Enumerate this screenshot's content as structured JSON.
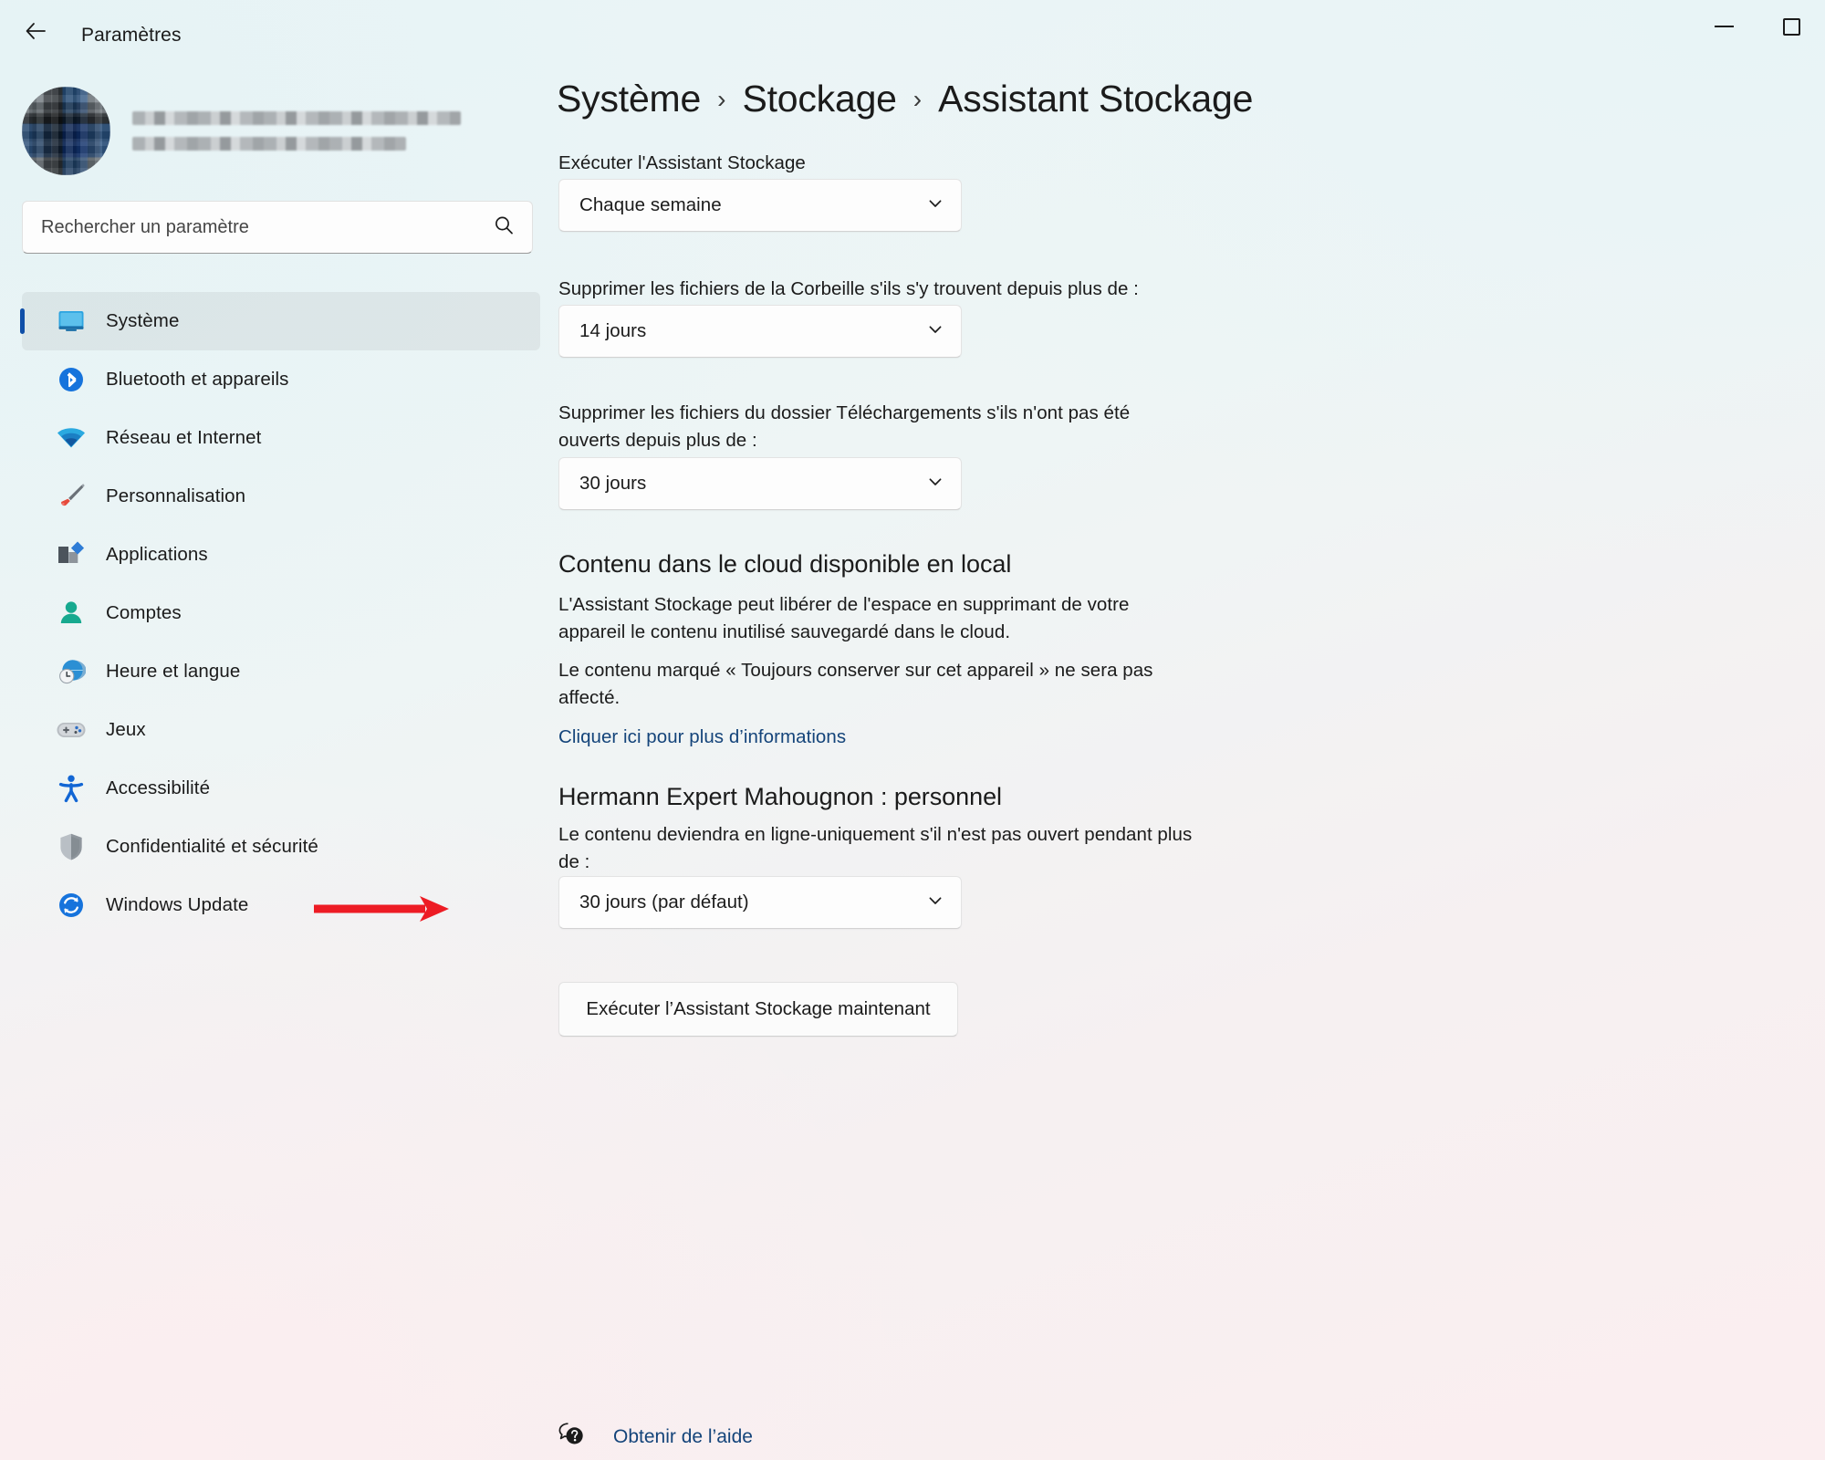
{
  "window": {
    "title": "Paramètres",
    "back_label": "Retour",
    "minimize_label": "Réduire",
    "maximize_label": "Agrandir"
  },
  "sidebar": {
    "account": {
      "name_redacted": "",
      "email_redacted": "",
      "avatar_label": "Photo de profil"
    },
    "search": {
      "placeholder": "Rechercher un paramètre",
      "value": "",
      "icon": "search-icon"
    },
    "items": [
      {
        "label": "Système",
        "icon": "monitor-icon",
        "selected": true
      },
      {
        "label": "Bluetooth et appareils",
        "icon": "bluetooth-icon",
        "selected": false
      },
      {
        "label": "Réseau et Internet",
        "icon": "wifi-icon",
        "selected": false
      },
      {
        "label": "Personnalisation",
        "icon": "paintbrush-icon",
        "selected": false
      },
      {
        "label": "Applications",
        "icon": "apps-icon",
        "selected": false
      },
      {
        "label": "Comptes",
        "icon": "person-icon",
        "selected": false
      },
      {
        "label": "Heure et langue",
        "icon": "clock-globe-icon",
        "selected": false
      },
      {
        "label": "Jeux",
        "icon": "gamepad-icon",
        "selected": false
      },
      {
        "label": "Accessibilité",
        "icon": "accessibility-icon",
        "selected": false
      },
      {
        "label": "Confidentialité et sécurité",
        "icon": "shield-icon",
        "selected": false
      },
      {
        "label": "Windows Update",
        "icon": "update-icon",
        "selected": false
      }
    ]
  },
  "main": {
    "breadcrumb": [
      {
        "label": "Système",
        "current": false
      },
      {
        "label": "Stockage",
        "current": false
      },
      {
        "label": "Assistant Stockage",
        "current": true
      }
    ],
    "breadcrumb_separator": "›",
    "run_schedule": {
      "label": "Exécuter l'Assistant Stockage",
      "value": "Chaque semaine",
      "chevron": "chevron-down-icon"
    },
    "recycle_bin": {
      "label": "Supprimer les fichiers de la Corbeille s'ils s'y trouvent depuis plus de :",
      "value": "14 jours",
      "chevron": "chevron-down-icon"
    },
    "downloads": {
      "label": "Supprimer les fichiers du dossier Téléchargements s'ils n'ont pas été ouverts depuis plus de :",
      "value": "30 jours",
      "chevron": "chevron-down-icon"
    },
    "cloud_section": {
      "heading": "Contenu dans le cloud disponible en local",
      "paragraph1": "L'Assistant Stockage peut libérer de l'espace en supprimant de votre appareil le contenu inutilisé sauvegardé dans le cloud.",
      "paragraph2": "Le contenu marqué « Toujours conserver sur cet appareil » ne sera pas affecté.",
      "link": "Cliquer ici pour plus d’informations"
    },
    "onedrive_section": {
      "heading": "Hermann Expert Mahougnon : personnel",
      "description": "Le contenu deviendra en ligne-uniquement s'il n'est pas ouvert pendant plus de :",
      "value": "30 jours (par défaut)",
      "chevron": "chevron-down-icon"
    },
    "run_now_button": "Exécuter l’Assistant Stockage maintenant",
    "help": {
      "label": "Obtenir de l’aide",
      "icon": "help-question-icon"
    }
  },
  "annotation": {
    "arrow_color": "#ED1C24",
    "arrow_points_to": "30 jours (par défaut)"
  }
}
